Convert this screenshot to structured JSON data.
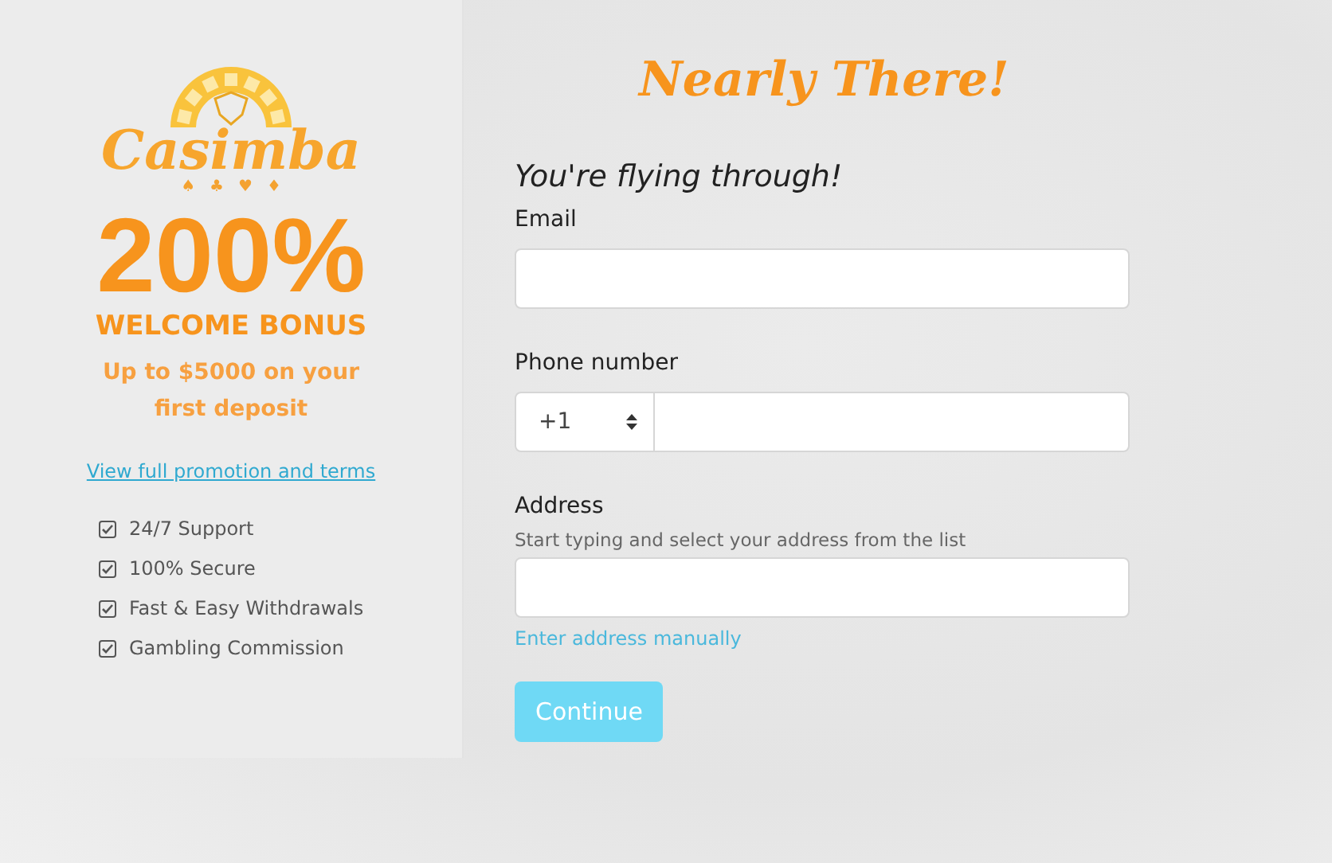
{
  "sidebar": {
    "logo": {
      "name": "Casimba",
      "suits": [
        "♠",
        "♣",
        "♥",
        "♦"
      ]
    },
    "bonus": {
      "amount": "200%",
      "title": "WELCOME BONUS",
      "subtitle": "Up to $5000 on your first deposit"
    },
    "terms_link": "View full promotion and terms",
    "features": [
      {
        "label": "24/7 Support",
        "checked": true
      },
      {
        "label": "100% Secure",
        "checked": true
      },
      {
        "label": "Fast & Easy Withdrawals",
        "checked": true
      },
      {
        "label": "Gambling Commission",
        "checked": true
      }
    ]
  },
  "form": {
    "heading": "Nearly There!",
    "subheading": "You're flying through!",
    "fields": [
      {
        "kind": "text",
        "label": "Email"
      },
      {
        "kind": "phone",
        "label": "Phone number",
        "country_code": "+1"
      },
      {
        "kind": "address",
        "label": "Address",
        "hint": "Start typing and select your address from the list",
        "link": "Enter address manually"
      }
    ],
    "submit": {
      "label": "Continue",
      "disabled": true
    }
  }
}
